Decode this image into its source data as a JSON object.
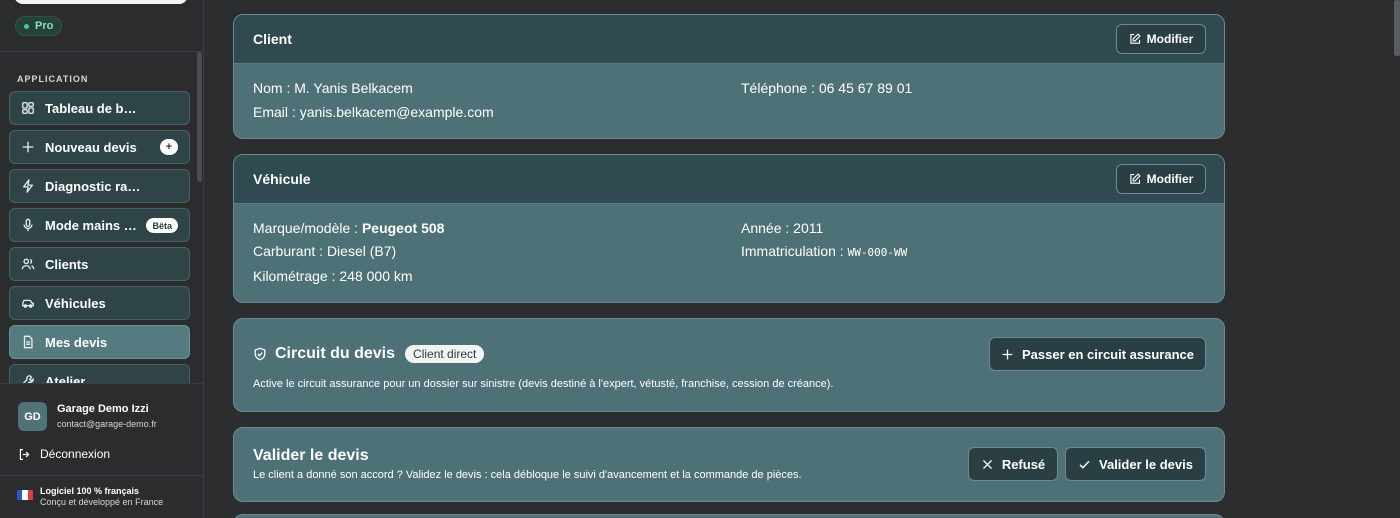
{
  "sidebar": {
    "plan_badge": "Pro",
    "section_label": "APPLICATION",
    "items": [
      {
        "label": "Tableau de bord",
        "icon": "dashboard-icon"
      },
      {
        "label": "Nouveau devis",
        "icon": "plus-icon",
        "badge": "+"
      },
      {
        "label": "Diagnostic rapide",
        "icon": "lightning-icon"
      },
      {
        "label": "Mode mains libres",
        "icon": "microphone-icon",
        "badge": "Bêta"
      },
      {
        "label": "Clients",
        "icon": "users-icon"
      },
      {
        "label": "Véhicules",
        "icon": "car-icon"
      },
      {
        "label": "Mes devis",
        "icon": "document-icon",
        "active": true
      },
      {
        "label": "Atelier",
        "icon": "wrench-icon"
      }
    ],
    "user": {
      "initials": "GD",
      "name": "Garage Demo Izzi",
      "email": "contact@garage-demo.fr"
    },
    "logout_label": "Déconnexion",
    "footer": {
      "title": "Logiciel 100 % français",
      "subtitle": "Conçu et développé en France"
    }
  },
  "client_card": {
    "title": "Client",
    "edit_label": "Modifier",
    "name_label": "Nom : ",
    "name_value": "M. Yanis Belkacem",
    "email_label": "Email : ",
    "email_value": "yanis.belkacem@example.com",
    "phone_label": "Téléphone : ",
    "phone_value": "06 45 67 89 01"
  },
  "vehicle_card": {
    "title": "Véhicule",
    "edit_label": "Modifier",
    "model_label": "Marque/modèle : ",
    "model_value": "Peugeot 508",
    "fuel_label": "Carburant : ",
    "fuel_value": "Diesel (B7)",
    "mileage_label": "Kilométrage : ",
    "mileage_value": "248 000 km",
    "year_label": "Année : ",
    "year_value": "2011",
    "plate_label": "Immatriculation : ",
    "plate_value": "WW-000-WW"
  },
  "circuit_card": {
    "title": "Circuit du devis",
    "status_pill": "Client direct",
    "action_label": "Passer en circuit assurance",
    "description": "Active le circuit assurance pour un dossier sur sinistre (devis destiné à l'expert, vétusté, franchise, cession de créance)."
  },
  "validate_card": {
    "title": "Valider le devis",
    "description": "Le client a donné son accord ? Validez le devis : cela débloque le suivi d'avancement et la commande de pièces.",
    "refuse_label": "Refusé",
    "validate_label": "Valider le devis"
  },
  "colors": {
    "card_body": "#4e7177",
    "card_header": "#2f4a50",
    "sidebar_active": "#557a80",
    "pro_dot": "#3fcf86"
  }
}
